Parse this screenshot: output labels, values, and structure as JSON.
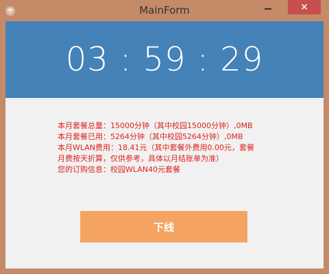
{
  "window": {
    "title": "MainForm",
    "close_label": "✕"
  },
  "timer": {
    "display": "03 : 59 : 29"
  },
  "info": {
    "line1": "本月套餐总量：15000分钟（其中校园15000分钟）,0MB",
    "line2": "本月套餐已用：5264分钟（其中校园5264分钟）,0MB",
    "line3": "本月WLAN费用：18.41元（其中套餐外费用0.00元，套餐",
    "line4": "月费按天折算，仅供参考，具体以月结账单为准）",
    "line5": "您的订购信息：校园WLAN40元套餐"
  },
  "actions": {
    "offline_label": "下线"
  },
  "colors": {
    "frame": "#c58a67",
    "timer_bg": "#4482b8",
    "info_text": "#e0221e",
    "button_bg": "#f4a460",
    "close_bg": "#c7504f"
  }
}
